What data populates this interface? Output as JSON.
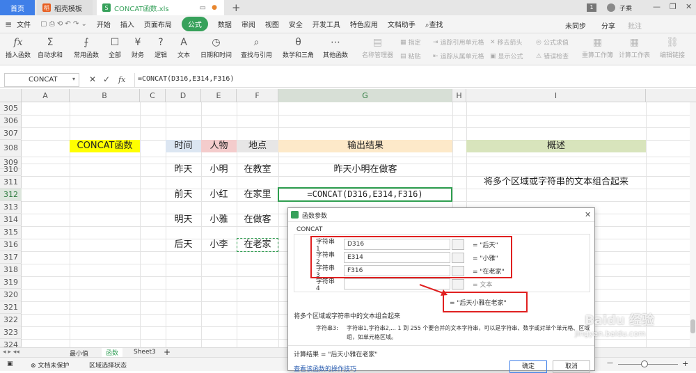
{
  "tabs": {
    "home": "首页",
    "template": "稻壳模板",
    "file": "CONCAT函数.xls",
    "page_badge": "1",
    "user": "子乘"
  },
  "menu": {
    "file": "文件",
    "items": [
      "开始",
      "插入",
      "页面布局",
      "公式",
      "数据",
      "审阅",
      "视图",
      "安全",
      "开发工具",
      "特色应用",
      "文档助手"
    ],
    "search": "查找",
    "sync": "未同步",
    "share": "分享",
    "comment": "批注"
  },
  "ribbon": {
    "insert_fn": "插入函数",
    "autosum": "自动求和",
    "common": "常用函数",
    "all": "全部",
    "finance": "财务",
    "logic": "逻辑",
    "text": "文本",
    "datetime": "日期和时间",
    "lookup": "查找与引用",
    "math": "数学和三角",
    "other": "其他函数",
    "name_mgr": "名称管理器",
    "paste": "粘贴",
    "specify": "指定",
    "trace_prec": "追踪引用单元格",
    "trace_dep": "追踪从属单元格",
    "remove_arrows": "移去箭头",
    "show_formula": "显示公式",
    "eval": "公式求值",
    "err_check": "错误检查",
    "recalc": "重算工作簿",
    "calc_sheet": "计算工作表",
    "edit_link": "编辑链接"
  },
  "formula": {
    "name_box": "CONCAT",
    "content": "=CONCAT(D316,E314,F316)"
  },
  "columns": [
    "A",
    "B",
    "C",
    "D",
    "E",
    "F",
    "G",
    "H",
    "I"
  ],
  "rows": [
    "305",
    "306",
    "307",
    "308",
    "309",
    "310",
    "311",
    "312",
    "313",
    "314",
    "315",
    "316",
    "317",
    "318",
    "319",
    "320",
    "321",
    "322",
    "323",
    "324"
  ],
  "cells": {
    "title": "CONCAT函数",
    "h_time": "时间",
    "h_person": "人物",
    "h_place": "地点",
    "h_output": "输出结果",
    "h_desc": "概述",
    "r310": [
      "昨天",
      "小明",
      "在教室",
      "昨天小明在做客"
    ],
    "r312": [
      "前天",
      "小红",
      "在家里",
      "=CONCAT(D316,E314,F316)"
    ],
    "r314": [
      "明天",
      "小雅",
      "在做客"
    ],
    "r316": [
      "后天",
      "小李",
      "在老家"
    ],
    "desc": "将多个区域或字符串的文本组合起来"
  },
  "colors": {
    "title_bg": "#ffff00",
    "time_bg": "#dce6f2",
    "person_bg": "#f4cccc",
    "place_bg": "#e7e6e6",
    "output_bg": "#fde9c9",
    "desc_bg": "#d8e4bc",
    "accent": "#37a15b"
  },
  "sheets": {
    "sheet1": "最小值",
    "sheet2": "函数",
    "sheet3": "Sheet3",
    "add": "+"
  },
  "status": {
    "doc_protect": "文档未保护",
    "region": "区域选择状态"
  },
  "dialog": {
    "title": "函数参数",
    "fn": "CONCAT",
    "args": [
      {
        "label": "字符串1",
        "value": "D316",
        "result": "= \"后天\""
      },
      {
        "label": "字符串2",
        "value": "E314",
        "result": "= \"小雅\""
      },
      {
        "label": "字符串3",
        "value": "F316",
        "result": "= \"在老家\""
      },
      {
        "label": "字符串4",
        "value": "",
        "result": "= 文本"
      }
    ],
    "total": "= \"后天小雅在老家\"",
    "desc": "将多个区域或字符串中的文本组合起来",
    "param_label": "字符串3:",
    "param_desc": "字符串1,字符串2,... 1 到 255 个要合并的文本字符串，可以是字符串、数字或对单个单元格、区域的引用",
    "param_desc2": "组，如单元格区域。",
    "calc_result": "计算结果 = \"后天小雅在老家\"",
    "help_link": "查看该函数的操作技巧",
    "ok": "确定",
    "cancel": "取消"
  },
  "watermark": {
    "text": "Baidu 经验",
    "url": "jingyan.baidu.com"
  }
}
